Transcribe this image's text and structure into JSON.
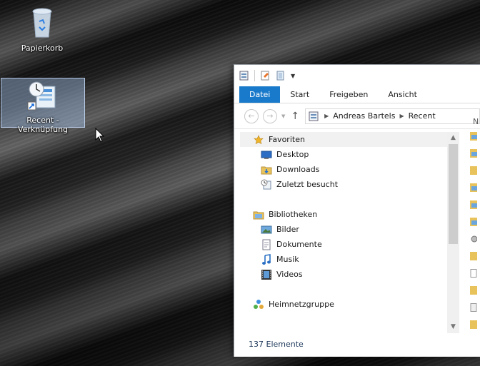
{
  "desktop": {
    "icons": [
      {
        "label": "Papierkorb",
        "icon": "recycle-bin-icon"
      },
      {
        "label": "Recent - Verknüpfung",
        "icon": "recent-shortcut-icon"
      }
    ]
  },
  "explorer": {
    "ribbon_tabs": [
      "Datei",
      "Start",
      "Freigeben",
      "Ansicht"
    ],
    "breadcrumb": [
      "Andreas Bartels",
      "Recent"
    ],
    "column_header": "N",
    "nav": {
      "favorites": {
        "label": "Favoriten",
        "items": [
          "Desktop",
          "Downloads",
          "Zuletzt besucht"
        ]
      },
      "libraries": {
        "label": "Bibliotheken",
        "items": [
          "Bilder",
          "Dokumente",
          "Musik",
          "Videos"
        ]
      },
      "homegroup": {
        "label": "Heimnetzgruppe"
      }
    },
    "status": "137 Elemente"
  },
  "colors": {
    "file_tab": "#1979ca",
    "status_text": "#1e395b"
  }
}
